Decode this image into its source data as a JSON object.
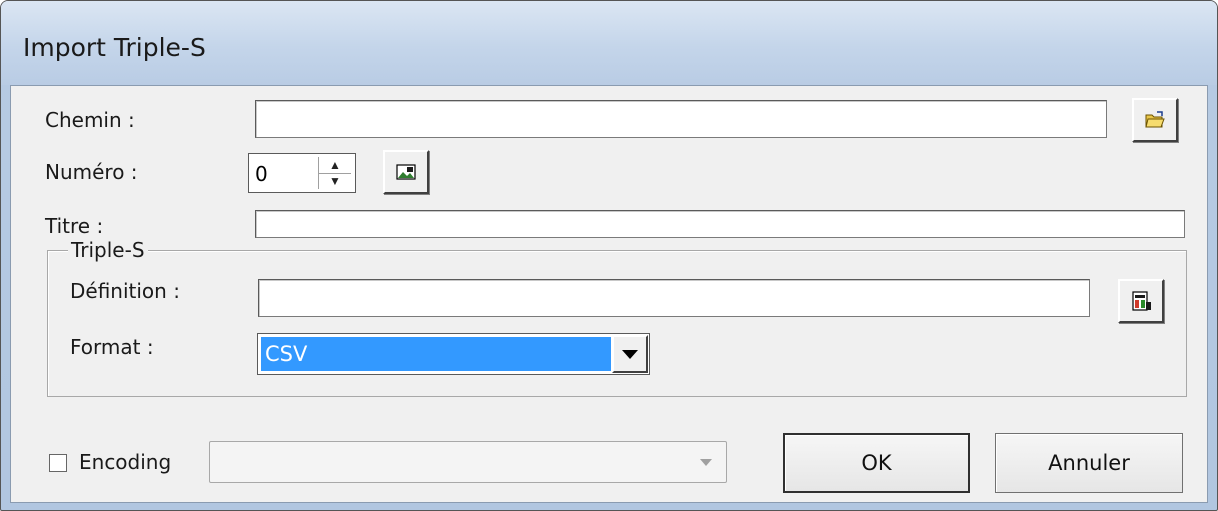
{
  "window": {
    "title": "Import Triple-S"
  },
  "fields": {
    "chemin_label": "Chemin :",
    "chemin_value": "",
    "numero_label": "Numéro :",
    "numero_value": "0",
    "titre_label": "Titre :",
    "titre_value": ""
  },
  "triples": {
    "group_label": "Triple-S",
    "definition_label": "Définition :",
    "definition_value": "",
    "format_label": "Format :",
    "format_value": "CSV"
  },
  "encoding": {
    "checkbox_label": "Encoding",
    "checked": false,
    "value": ""
  },
  "buttons": {
    "ok": "OK",
    "cancel": "Annuler"
  },
  "icons": {
    "browse": "open-folder-icon",
    "numero_action": "image-icon",
    "definition_browse": "definition-file-icon"
  }
}
